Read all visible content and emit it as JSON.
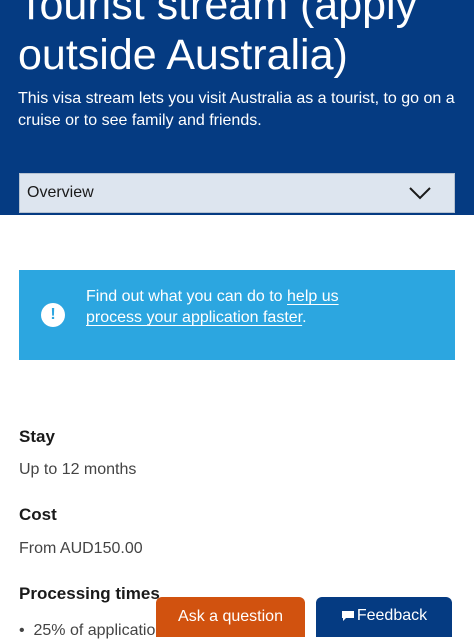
{
  "hero": {
    "title_line1": "Tourist stream (apply",
    "title_line2": "outside Australia)",
    "description": "This visa stream lets you visit Australia as a tourist, to go on a cruise or to see family and friends."
  },
  "section_select": {
    "selected": "Overview",
    "icon": "chevron-down-icon"
  },
  "info_banner": {
    "icon": "exclamation-circle-icon",
    "text_before": "Find out what you can do to ",
    "link_text": "help us process your application faster",
    "text_after": "."
  },
  "facts": {
    "stay_label": "Stay",
    "stay_value": "Up to 12 months",
    "cost_label": "Cost",
    "cost_value": "From AUD150.00",
    "processing_label": "Processing times",
    "processing_bullet": "25% of applicatio"
  },
  "actions": {
    "ask_label": "Ask a question",
    "feedback_label": "Feedback",
    "feedback_icon": "speech-bubble-icon"
  },
  "colors": {
    "hero_bg": "#053b82",
    "banner_bg": "#2ca6e0",
    "ask_bg": "#d1520f"
  }
}
